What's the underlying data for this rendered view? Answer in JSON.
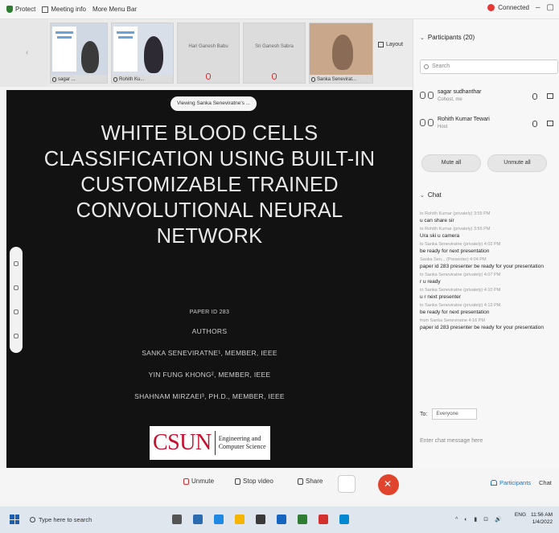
{
  "topbar": {
    "protect_label": "Protect",
    "meeting_info_label": "Meeting info",
    "more_menu_label": "More Menu Bar",
    "connected_label": "Connected",
    "minimize": "–",
    "restore": "▢"
  },
  "video_strip": {
    "tiles": [
      {
        "name": "sagar ..."
      },
      {
        "name": "Rohith Ku..."
      },
      {
        "name": "",
        "center": "Hari Ganesh Babu"
      },
      {
        "name": "",
        "center": "Sri Ganesh Sabra"
      },
      {
        "name": "Sanka Senevirat..."
      }
    ],
    "layout_label": "Layout"
  },
  "stage": {
    "viewing_label": "Viewing Sanka Seneviratne's ...",
    "title_lines": [
      "WHITE BLOOD CELLS",
      "CLASSIFICATION USING BUILT-IN",
      "CUSTOMIZABLE TRAINED",
      "CONVOLUTIONAL NEURAL",
      "NETWORK"
    ],
    "paper_id": "PAPER ID 283",
    "authors_heading": "AUTHORS",
    "author_1": "SANKA SENEVIRATNE¹, MEMBER, IEEE",
    "author_2": "YIN FUNG KHONG², MEMBER, IEEE",
    "author_3": "SHAHNAM MIRZAEI³, PH.D., MEMBER, IEEE",
    "logo_main": "CSUN",
    "logo_line1": "Engineering and",
    "logo_line2": "Computer Science"
  },
  "panel": {
    "participants_header": "Participants (20)",
    "search_placeholder": "Search",
    "participants": [
      {
        "name": "sagar sudhanthar",
        "role": "Cohost, me"
      },
      {
        "name": "Rohith Kumar Tewari",
        "role": "Host"
      }
    ],
    "mute_all": "Mute all",
    "unmute_all": "Unmute all",
    "chat_header": "Chat",
    "chat": [
      {
        "meta": "to Rohith Kumar (privately) 3:55 PM",
        "text": "u can share sir"
      },
      {
        "meta": "to Rohith Kumar (privately) 3:55 PM",
        "text": "Ura ski u camera"
      },
      {
        "meta": "to Sanka Seneviratne (privately) 4:02 PM",
        "text": "be ready for next presentation"
      },
      {
        "meta": "Sanka Sen... (Presenter) 4:04 PM",
        "text": "paper id 283 presenter be ready for your presentation"
      },
      {
        "meta": "to Sanka Seneviratne (privately) 4:07 PM",
        "text": "r u ready"
      },
      {
        "meta": "to Sanka Seneviratne (privately) 4:10 PM",
        "text": "u r next presenter"
      },
      {
        "meta": "to Sanka Seneviratne (privately) 4:13 PM",
        "text": "be ready for next presentation"
      },
      {
        "meta": "from Sanka Seneviratne 4:16 PM",
        "text": "paper id 283 presenter be ready for your presentation"
      }
    ],
    "chat_to_label": "To:",
    "chat_to_value": "Everyone",
    "chat_input_placeholder": "Enter chat message here"
  },
  "controls": {
    "unmute": "Unmute",
    "stop_video": "Stop video",
    "share": "Share",
    "participants": "Participants",
    "chat": "Chat"
  },
  "taskbar": {
    "search_placeholder": "Type here to search",
    "time": "11:56 AM",
    "date": "1/4/2022",
    "lang": "ENG"
  }
}
